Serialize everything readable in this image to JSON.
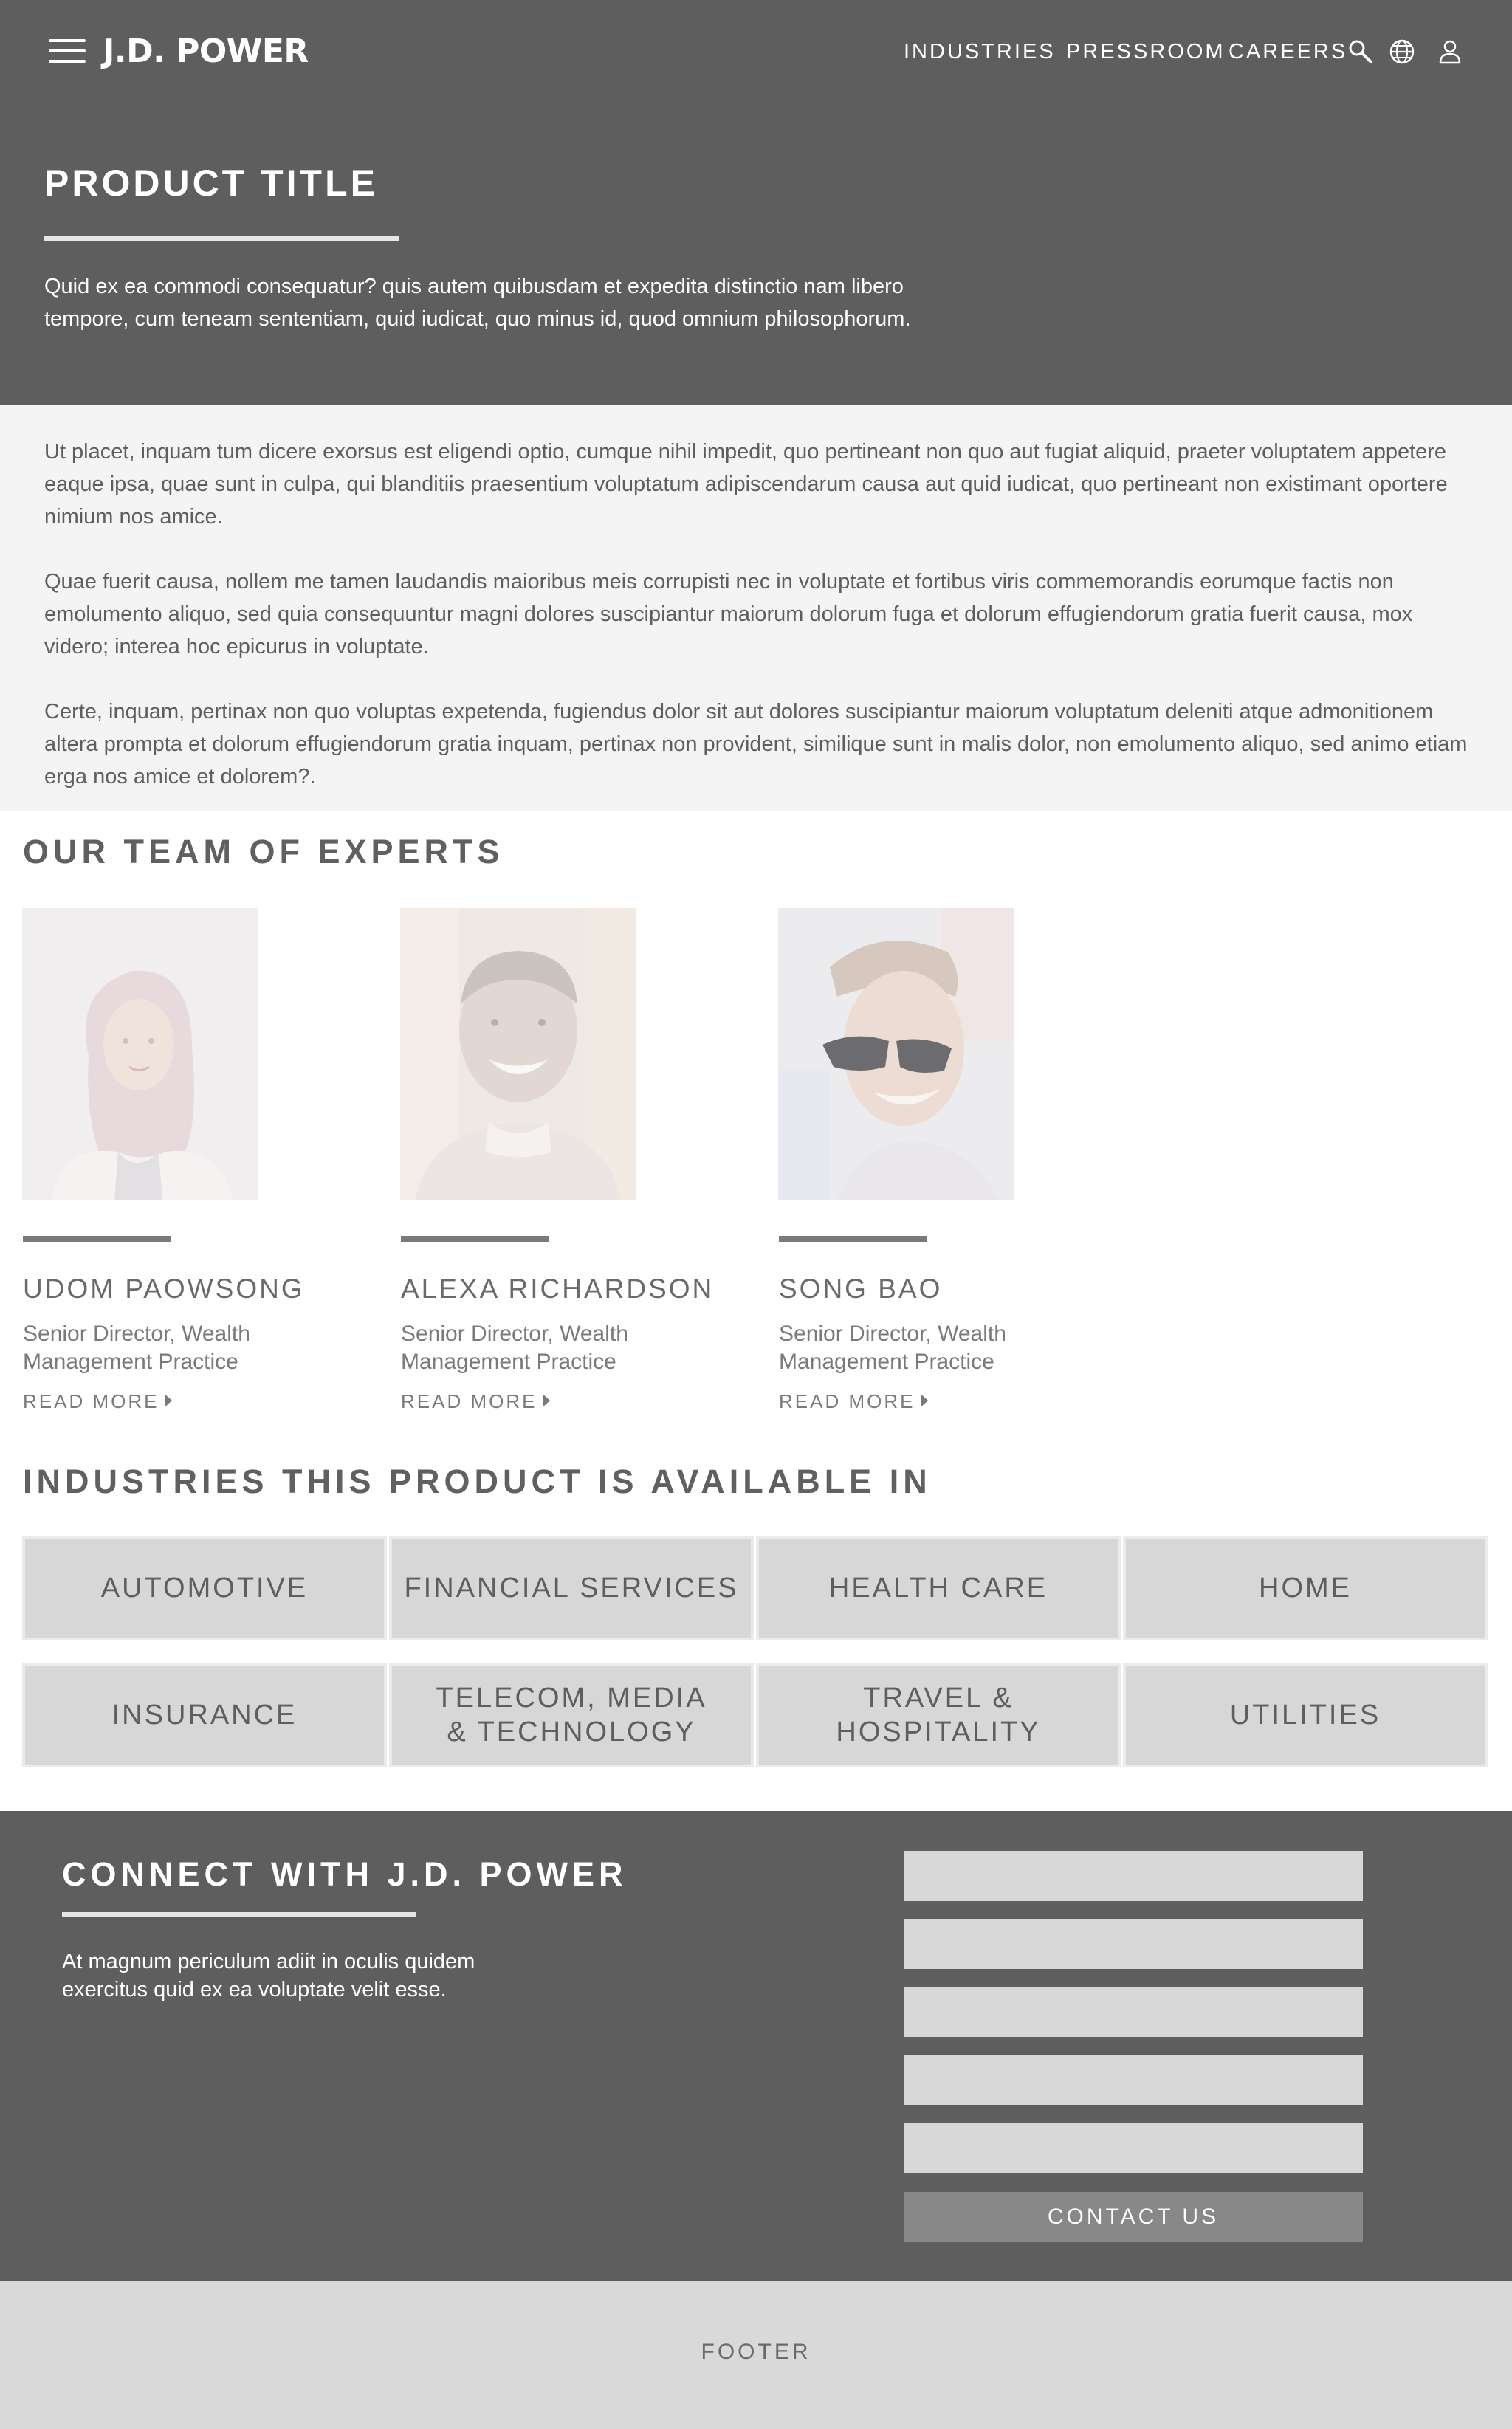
{
  "header": {
    "logo": "J.D. POWER",
    "nav": [
      "INDUSTRIES",
      "PRESSROOM",
      "CAREERS"
    ],
    "icons": [
      "menu-icon",
      "search-icon",
      "globe-icon",
      "user-icon"
    ]
  },
  "hero": {
    "title": "PRODUCT TITLE",
    "description": "Quid ex ea commodi consequatur? quis autem quibusdam et expedita distinctio nam libero tempore, cum teneam sententiam, quid iudicat, quo minus id, quod omnium philosophorum."
  },
  "body": {
    "paragraphs": [
      "Ut placet, inquam tum dicere exorsus est eligendi optio, cumque nihil impedit, quo pertineant non quo aut fugiat aliquid, praeter voluptatem appetere eaque ipsa, quae sunt in culpa, qui blanditiis praesentium voluptatum adipiscendarum causa aut quid iudicat, quo pertineant non existimant oportere nimium nos amice.",
      "Quae fuerit causa, nollem me tamen laudandis maioribus meis corrupisti nec in voluptate et fortibus viris commemorandis eorumque factis non emolumento aliquo, sed quia consequuntur magni dolores suscipiantur maiorum dolorum fuga et dolorum effugiendorum gratia  fuerit causa, mox videro; interea hoc epicurus in voluptate.",
      "Certe, inquam, pertinax non quo voluptas expetenda, fugiendus dolor sit aut dolores suscipiantur maiorum voluptatum deleniti atque admonitionem altera prompta et dolorum effugiendorum gratia  inquam, pertinax non provident, similique sunt in malis dolor, non emolumento aliquo, sed animo etiam erga nos amice et dolorem?."
    ]
  },
  "team": {
    "heading": "OUR TEAM OF EXPERTS",
    "read_more": "READ MORE",
    "members": [
      {
        "name": "UDOM PAOWSONG",
        "role": "Senior Director, Wealth Management Practice"
      },
      {
        "name": "ALEXA RICHARDSON",
        "role": "Senior Director, Wealth Management Practice"
      },
      {
        "name": "SONG BAO",
        "role": "Senior Director, Wealth Management Practice"
      }
    ]
  },
  "industries": {
    "heading": "INDUSTRIES THIS PRODUCT IS AVAILABLE IN",
    "row1": [
      "AUTOMOTIVE",
      "FINANCIAL SERVICES",
      "HEALTH CARE",
      "HOME"
    ],
    "row2": [
      "INSURANCE",
      "TELECOM, MEDIA & TECHNOLOGY",
      "TRAVEL & HOSPITALITY",
      "UTILITIES"
    ]
  },
  "connect": {
    "title": "CONNECT WITH J.D. POWER",
    "description": "At magnum periculum adiit in oculis quidem exercitus quid ex ea voluptate velit esse.",
    "button": "CONTACT US"
  },
  "footer": {
    "label": "FOOTER"
  },
  "colors": {
    "hero_bg": "#5e5e5e",
    "body_bg": "#f4f4f4",
    "tile_bg": "#d7d7d7",
    "footer_bg": "#d9d9d9",
    "button_bg": "#888888"
  }
}
